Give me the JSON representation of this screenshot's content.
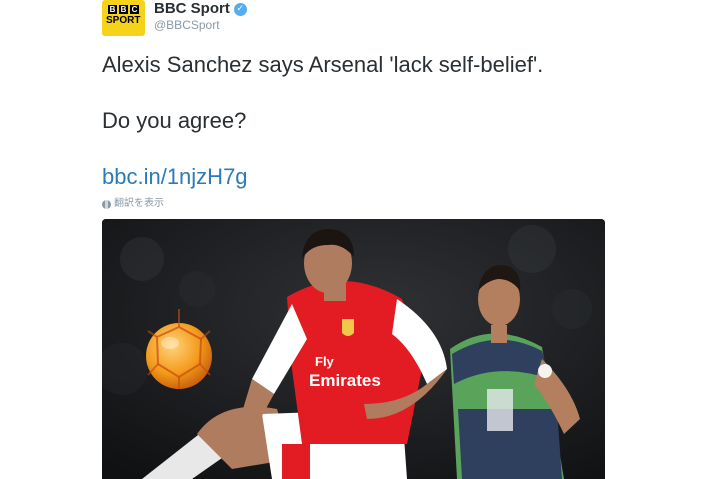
{
  "account": {
    "avatar_bbc_letters": [
      "B",
      "B",
      "C"
    ],
    "avatar_sport_text": "SPORT",
    "display_name": "BBC Sport",
    "handle": "@BBCSport",
    "verified_icon": "verified-check-icon",
    "verified_glyph": "✓"
  },
  "tweet": {
    "line1": "Alexis Sanchez says Arsenal 'lack self-belief'.",
    "line2": "Do you agree?",
    "link": "bbc.in/1njzH7g",
    "translate_label": "翻訳を表示",
    "translate_icon": "globe-icon"
  },
  "media": {
    "description_icon": "photo",
    "jersey_sponsor": "Fly Emirates",
    "colors": {
      "arsenal_red": "#e31b23",
      "swansea_green": "#5aa35a",
      "pitch_dark": "#191b1d",
      "ball_orange": "#f39a1a"
    }
  },
  "colors": {
    "text": "#292f33",
    "muted": "#8899a6",
    "link": "#2b7bb9",
    "verified": "#55acee",
    "bbc_yellow": "#f5d31b"
  }
}
